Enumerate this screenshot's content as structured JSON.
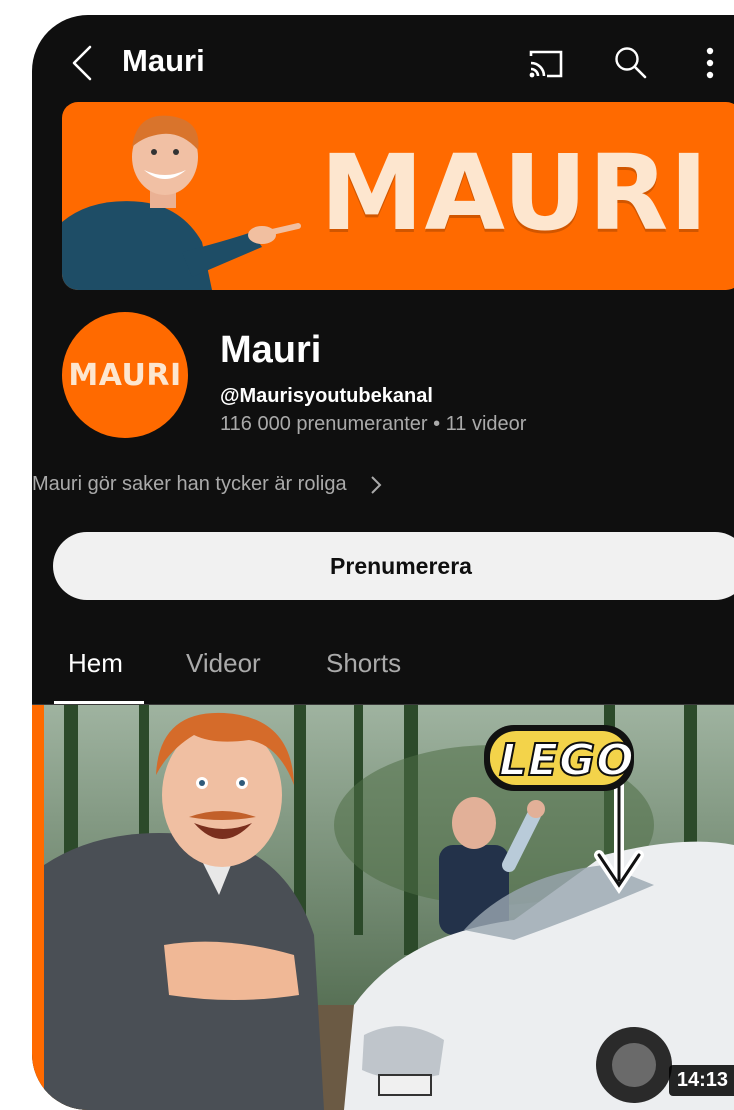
{
  "header": {
    "title": "Mauri",
    "icons": [
      "back-arrow-icon",
      "cast-icon",
      "search-icon",
      "more-vertical-icon"
    ]
  },
  "banner": {
    "text": "MAURI",
    "background_color": "#ff6a00",
    "text_color": "#fde6cf"
  },
  "channel": {
    "avatar_text": "MAURI",
    "name": "Mauri",
    "handle": "@Maurisyoutubekanal",
    "stats": "116 000 prenumeranter • 11 videor",
    "description": "Mauri gör saker han tycker är roliga"
  },
  "subscribe_button": {
    "label": "Prenumerera"
  },
  "tabs": [
    {
      "label": "Hem",
      "active": true
    },
    {
      "label": "Videor",
      "active": false
    },
    {
      "label": "Shorts",
      "active": false
    }
  ],
  "video": {
    "thumbnail_text": "LEGO",
    "duration": "14:13"
  }
}
